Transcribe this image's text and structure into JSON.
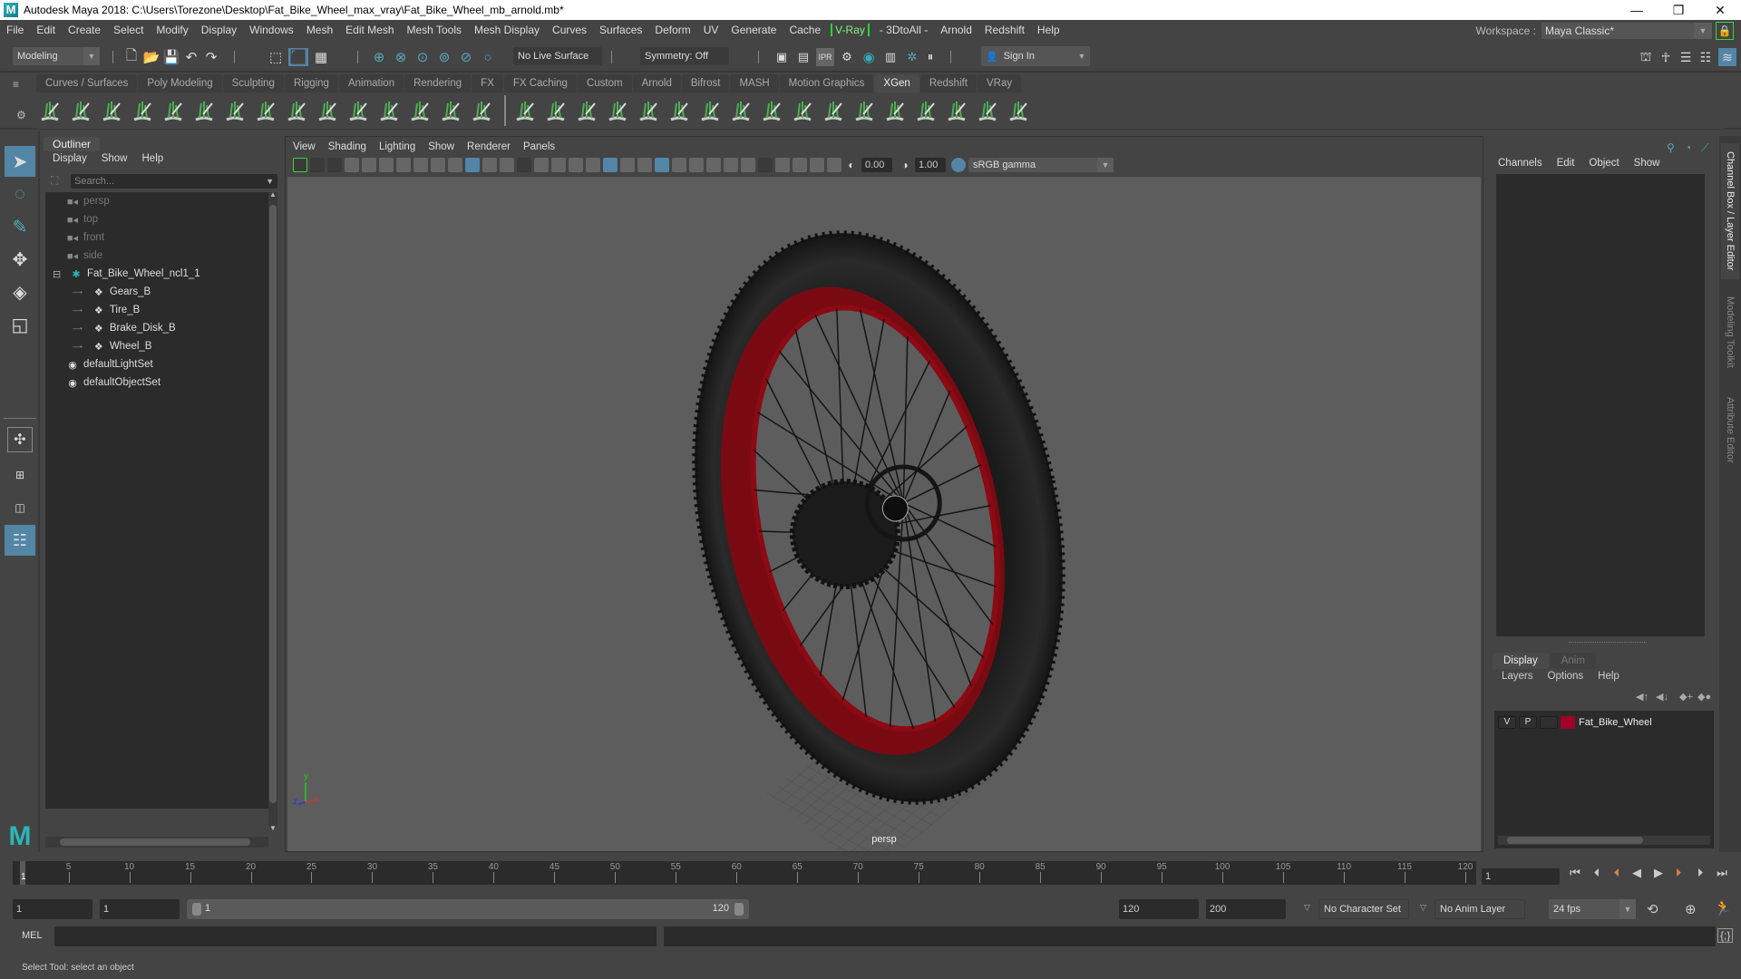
{
  "window": {
    "title": "Autodesk Maya 2018: C:\\Users\\Torezone\\Desktop\\Fat_Bike_Wheel_max_vray\\Fat_Bike_Wheel_mb_arnold.mb*",
    "minimize": "—",
    "maximize": "❐",
    "close": "✕"
  },
  "menubar": [
    "File",
    "Edit",
    "Create",
    "Select",
    "Modify",
    "Display",
    "Windows",
    "Mesh",
    "Edit Mesh",
    "Mesh Tools",
    "Mesh Display",
    "Curves",
    "Surfaces",
    "Deform",
    "UV",
    "Generate",
    "Cache",
    "V-Ray",
    "- 3DtoAll -",
    "Arnold",
    "Redshift",
    "Help"
  ],
  "workspace": {
    "label": "Workspace :",
    "value": "Maya Classic*"
  },
  "statusline": {
    "menuset": "Modeling",
    "live_surface": "No Live Surface",
    "symmetry": "Symmetry: Off",
    "sign_in": "Sign In"
  },
  "shelf": {
    "tabs": [
      "Curves / Surfaces",
      "Poly Modeling",
      "Sculpting",
      "Rigging",
      "Animation",
      "Rendering",
      "FX",
      "FX Caching",
      "Custom",
      "Arnold",
      "Bifrost",
      "MASH",
      "Motion Graphics",
      "XGen",
      "Redshift",
      "VRay"
    ],
    "active_tab": "XGen"
  },
  "outliner": {
    "tab": "Outliner",
    "menu": [
      "Display",
      "Show",
      "Help"
    ],
    "search_placeholder": "Search...",
    "items": [
      {
        "label": "persp",
        "type": "camera",
        "dim": true
      },
      {
        "label": "top",
        "type": "camera",
        "dim": true
      },
      {
        "label": "front",
        "type": "camera",
        "dim": true
      },
      {
        "label": "side",
        "type": "camera",
        "dim": true
      },
      {
        "label": "Fat_Bike_Wheel_ncl1_1",
        "type": "group",
        "expanded": true
      },
      {
        "label": "Gears_B",
        "type": "mesh",
        "child": true
      },
      {
        "label": "Tire_B",
        "type": "mesh",
        "child": true
      },
      {
        "label": "Brake_Disk_B",
        "type": "mesh",
        "child": true
      },
      {
        "label": "Wheel_B",
        "type": "mesh",
        "child": true
      },
      {
        "label": "defaultLightSet",
        "type": "set"
      },
      {
        "label": "defaultObjectSet",
        "type": "set"
      }
    ]
  },
  "viewport": {
    "menu": [
      "View",
      "Shading",
      "Lighting",
      "Show",
      "Renderer",
      "Panels"
    ],
    "exposure": "0.00",
    "gamma": "1.00",
    "color_space": "sRGB gamma",
    "camera_label": "persp",
    "axis": {
      "x": "x",
      "y": "y",
      "z": "z"
    }
  },
  "channelbox": {
    "menu": [
      "Channels",
      "Edit",
      "Object",
      "Show"
    ],
    "layer_tabs": [
      "Display",
      "Anim"
    ],
    "layer_menu": [
      "Layers",
      "Options",
      "Help"
    ],
    "layers": [
      {
        "v": "V",
        "p": "P",
        "name": "Fat_Bike_Wheel",
        "color": "#a0002a"
      }
    ]
  },
  "sidetabs": [
    "Channel Box / Layer Editor",
    "Modeling Toolkit",
    "Attribute Editor"
  ],
  "timeline": {
    "ticks": [
      5,
      10,
      15,
      20,
      25,
      30,
      35,
      40,
      45,
      50,
      55,
      60,
      65,
      70,
      75,
      80,
      85,
      90,
      95,
      100,
      105,
      110,
      115,
      120
    ],
    "min": 1,
    "max": 120,
    "current_frame": "1",
    "current_field": "1"
  },
  "range": {
    "anim_start": "1",
    "play_start": "1",
    "slider_start": "1",
    "slider_end": "120",
    "play_end": "120",
    "anim_end": "200",
    "character_set": "No Character Set",
    "anim_layer": "No Anim Layer",
    "fps": "24 fps"
  },
  "cmdline": {
    "label": "MEL"
  },
  "helpline": {
    "text": "Select Tool: select an object"
  },
  "colors": {
    "accent": "#5285a6",
    "vray": "#2fd42f",
    "rim": "#8b0a14",
    "layer": "#a0002a"
  }
}
